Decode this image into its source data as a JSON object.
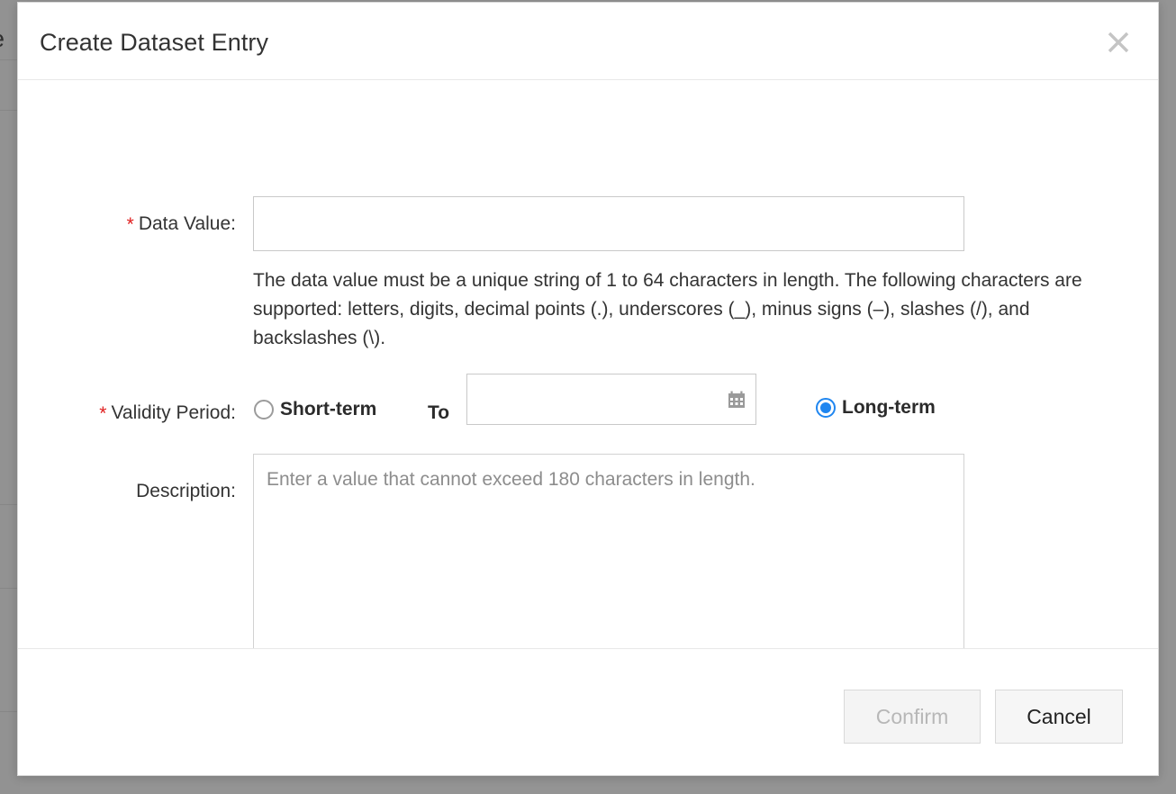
{
  "background": {
    "visible_text": "e"
  },
  "dialog": {
    "title": "Create Dataset Entry",
    "close_icon": "close-icon",
    "fields": {
      "data_value": {
        "label": "Data Value:",
        "required_marker": "*",
        "value": "",
        "placeholder": "",
        "help_text": "The data value must be a unique string of 1 to 64 characters in length. The following characters are supported: letters, digits, decimal points (.), underscores (_), minus signs (–), slashes (/), and backslashes (\\)."
      },
      "validity_period": {
        "label": "Validity Period:",
        "required_marker": "*",
        "options": [
          {
            "label": "Short-term",
            "selected": false
          },
          {
            "label": "Long-term",
            "selected": true
          }
        ],
        "short_term_label": "Short-term",
        "long_term_label": "Long-term",
        "to_label": "To",
        "date_value": "",
        "date_placeholder": "",
        "calendar_icon": "calendar-icon",
        "selected_option": "Long-term"
      },
      "description": {
        "label": "Description:",
        "value": "",
        "placeholder": "Enter a value that cannot exceed 180 characters in length."
      }
    },
    "footer": {
      "confirm_label": "Confirm",
      "confirm_disabled": true,
      "cancel_label": "Cancel"
    }
  },
  "colors": {
    "required_red": "#e02020",
    "radio_accent": "#1f86f0",
    "border": "#c9c9c9",
    "disabled_text": "#b7b7b7",
    "text": "#333333",
    "overlay": "rgba(60,60,60,0.55)"
  }
}
